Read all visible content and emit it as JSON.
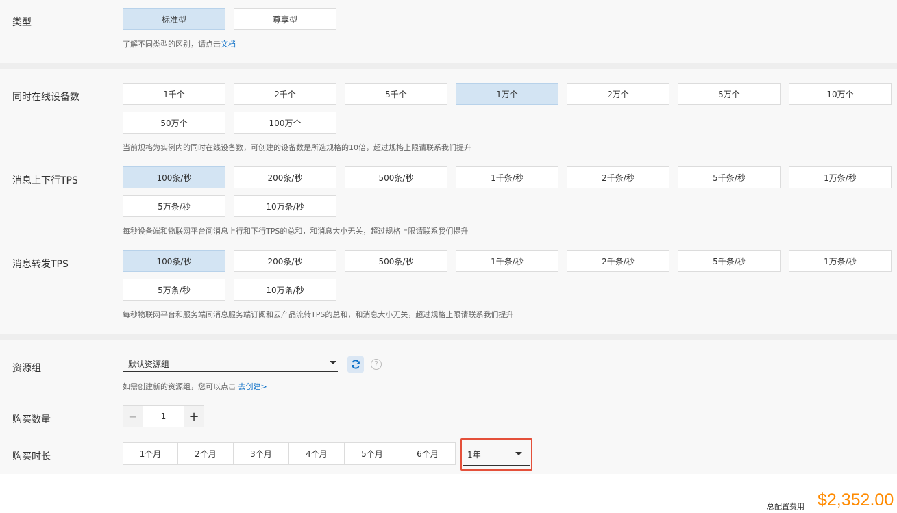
{
  "type": {
    "label": "类型",
    "options": [
      "标准型",
      "尊享型"
    ],
    "selected": "标准型",
    "hint_prefix": "了解不同类型的区别，请点击",
    "hint_link": "文档"
  },
  "devices": {
    "label": "同时在线设备数",
    "options": [
      "1千个",
      "2千个",
      "5千个",
      "1万个",
      "2万个",
      "5万个",
      "10万个",
      "50万个",
      "100万个"
    ],
    "selected": "1万个",
    "hint": "当前规格为实例内的同时在线设备数，可创建的设备数是所选规格的10倍，超过规格上限请联系我们提升"
  },
  "tps_updown": {
    "label": "消息上下行TPS",
    "options": [
      "100条/秒",
      "200条/秒",
      "500条/秒",
      "1千条/秒",
      "2千条/秒",
      "5千条/秒",
      "1万条/秒",
      "5万条/秒",
      "10万条/秒"
    ],
    "selected": "100条/秒",
    "hint": "每秒设备端和物联网平台间消息上行和下行TPS的总和，和消息大小无关，超过规格上限请联系我们提升"
  },
  "tps_forward": {
    "label": "消息转发TPS",
    "options": [
      "100条/秒",
      "200条/秒",
      "500条/秒",
      "1千条/秒",
      "2千条/秒",
      "5千条/秒",
      "1万条/秒",
      "5万条/秒",
      "10万条/秒"
    ],
    "selected": "100条/秒",
    "hint": "每秒物联网平台和服务端间消息服务端订阅和云产品流转TPS的总和，和消息大小无关，超过规格上限请联系我们提升"
  },
  "resource_group": {
    "label": "资源组",
    "value": "默认资源组",
    "hint_prefix": "如需创建新的资源组，您可以点击",
    "hint_link": "去创建>"
  },
  "quantity": {
    "label": "购买数量",
    "minus": "−",
    "value": "1",
    "plus": "+"
  },
  "duration": {
    "label": "购买时长",
    "options": [
      "1个月",
      "2个月",
      "3个月",
      "4个月",
      "5个月",
      "6个月"
    ],
    "select_value": "1年"
  },
  "total": {
    "label": "总配置费用",
    "price": "$2,352.00"
  },
  "colors": {
    "selected_bg": "#d3e4f3",
    "link": "#0b6fc7",
    "price": "#ff8a00",
    "highlight_border": "#e4503a"
  }
}
